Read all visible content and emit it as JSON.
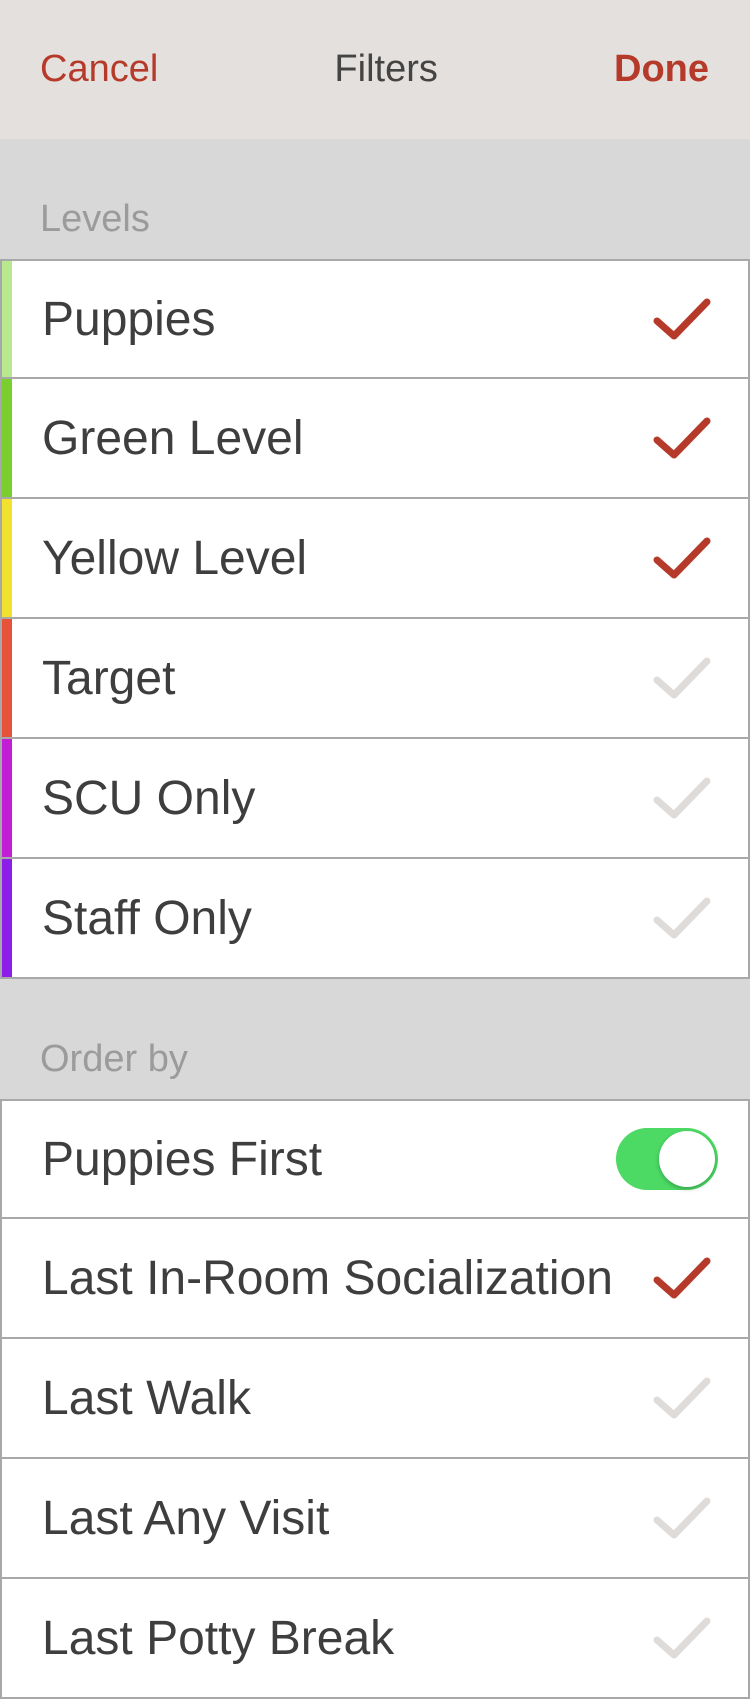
{
  "nav": {
    "cancel_label": "Cancel",
    "title": "Filters",
    "done_label": "Done"
  },
  "accent_color": "#b63a2a",
  "levels": {
    "header": "Levels",
    "items": [
      {
        "label": "Puppies",
        "color": "#b9e98f",
        "checked": true,
        "check_icon": "checkmark-icon"
      },
      {
        "label": "Green Level",
        "color": "#78cf2e",
        "checked": true,
        "check_icon": "checkmark-icon"
      },
      {
        "label": "Yellow Level",
        "color": "#f2e22e",
        "checked": true,
        "check_icon": "checkmark-icon"
      },
      {
        "label": "Target",
        "color": "#e5533a",
        "checked": false,
        "check_icon": "checkmark-icon"
      },
      {
        "label": "SCU Only",
        "color": "#c21ed6",
        "checked": false,
        "check_icon": "checkmark-icon"
      },
      {
        "label": "Staff Only",
        "color": "#8d1ee8",
        "checked": false,
        "check_icon": "checkmark-icon"
      }
    ]
  },
  "order_by": {
    "header": "Order by",
    "toggle_row": {
      "label": "Puppies First",
      "on": true,
      "on_color": "#4cd964"
    },
    "items": [
      {
        "label": "Last In-Room Socialization",
        "checked": true,
        "check_icon": "checkmark-icon"
      },
      {
        "label": "Last Walk",
        "checked": false,
        "check_icon": "checkmark-icon"
      },
      {
        "label": "Last Any Visit",
        "checked": false,
        "check_icon": "checkmark-icon"
      },
      {
        "label": "Last Potty Break",
        "checked": false,
        "check_icon": "checkmark-icon"
      }
    ]
  }
}
